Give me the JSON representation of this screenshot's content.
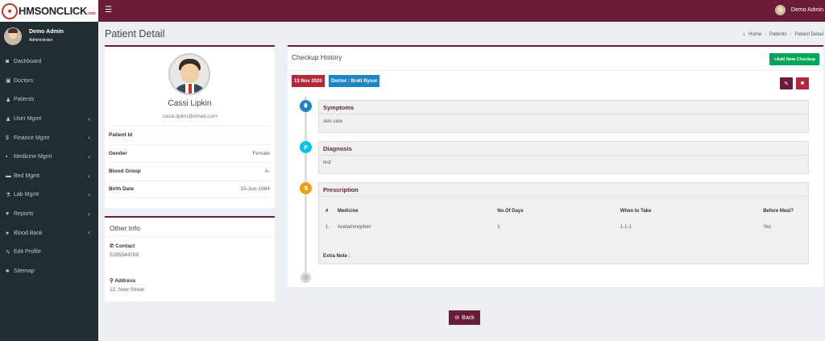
{
  "brand": {
    "logo_text": "HMSONCLICK",
    "logo_domain": ".com"
  },
  "sidebar": {
    "user_name": "Demo Admin",
    "user_role": "Administrator",
    "items": [
      {
        "label": "Dashboard",
        "icon": "dashboard-icon",
        "glyph": "◙",
        "has_children": false
      },
      {
        "label": "Doctors",
        "icon": "doctors-icon",
        "glyph": "▣",
        "has_children": false
      },
      {
        "label": "Patients",
        "icon": "patients-icon",
        "glyph": "♟",
        "has_children": false
      },
      {
        "label": "User Mgmt",
        "icon": "user-icon",
        "glyph": "♟",
        "has_children": true
      },
      {
        "label": "Finance Mgmt",
        "icon": "dollar-icon",
        "glyph": "$",
        "has_children": true
      },
      {
        "label": "Medicine Mgmt",
        "icon": "medkit-icon",
        "glyph": "▪",
        "has_children": true
      },
      {
        "label": "Bed Mgmt",
        "icon": "bed-icon",
        "glyph": "▬",
        "has_children": true
      },
      {
        "label": "Lab Mgmt",
        "icon": "flask-icon",
        "glyph": "⚗",
        "has_children": true
      },
      {
        "label": "Reports",
        "icon": "reports-icon",
        "glyph": "♥",
        "has_children": true
      },
      {
        "label": "Blood Bank",
        "icon": "blood-icon",
        "glyph": "●",
        "has_children": true
      },
      {
        "label": "Edit Profile",
        "icon": "edit-icon",
        "glyph": "✎",
        "has_children": false
      },
      {
        "label": "Sitemap",
        "icon": "sitemap-icon",
        "glyph": "♣",
        "has_children": false
      }
    ]
  },
  "topbar": {
    "user_name": "Demo Admin"
  },
  "page": {
    "title": "Patient Detail"
  },
  "breadcrumb": [
    "Home",
    "Patients",
    "Patient Detail"
  ],
  "profile": {
    "name": "Cassi Lipkin",
    "email": "cassi.lipkin@email.com",
    "rows": [
      {
        "label": "Patient Id",
        "value": ""
      },
      {
        "label": "Gender",
        "value": "Female"
      },
      {
        "label": "Blood Group",
        "value": "A-"
      },
      {
        "label": "Birth Date",
        "value": "15-Jun-1984"
      }
    ]
  },
  "other_info": {
    "title": "Other Info",
    "contact_label": "Contact",
    "contact_value": "5285544789",
    "address_label": "Address",
    "address_value": "12, New Street"
  },
  "history": {
    "title": "Checkup History",
    "add_button": "Add New Checkup",
    "date": "13 Nov 2020",
    "doctor": "Doctor : Brett Rysor",
    "symptoms_title": "Symptoms",
    "symptoms_text": "skin care",
    "diagnosis_title": "Diagnosis",
    "diagnosis_text": "test",
    "prescription_title": "Prescription",
    "columns": [
      "#",
      "Medicine",
      "No.Of Days",
      "When to Take",
      "Before Meal?"
    ],
    "rows": [
      {
        "no": "1.",
        "medicine": "Acetaminophen",
        "days": "1",
        "when": "1-1-1",
        "before_meal": "Yes"
      }
    ],
    "extra_note": "Extra Note :"
  },
  "back_button": "Back",
  "colors": {
    "primary": "#6b1d37",
    "sidebar": "#222d32",
    "success": "#00a65a",
    "info": "#1d85c5",
    "danger": "#b5263a"
  }
}
